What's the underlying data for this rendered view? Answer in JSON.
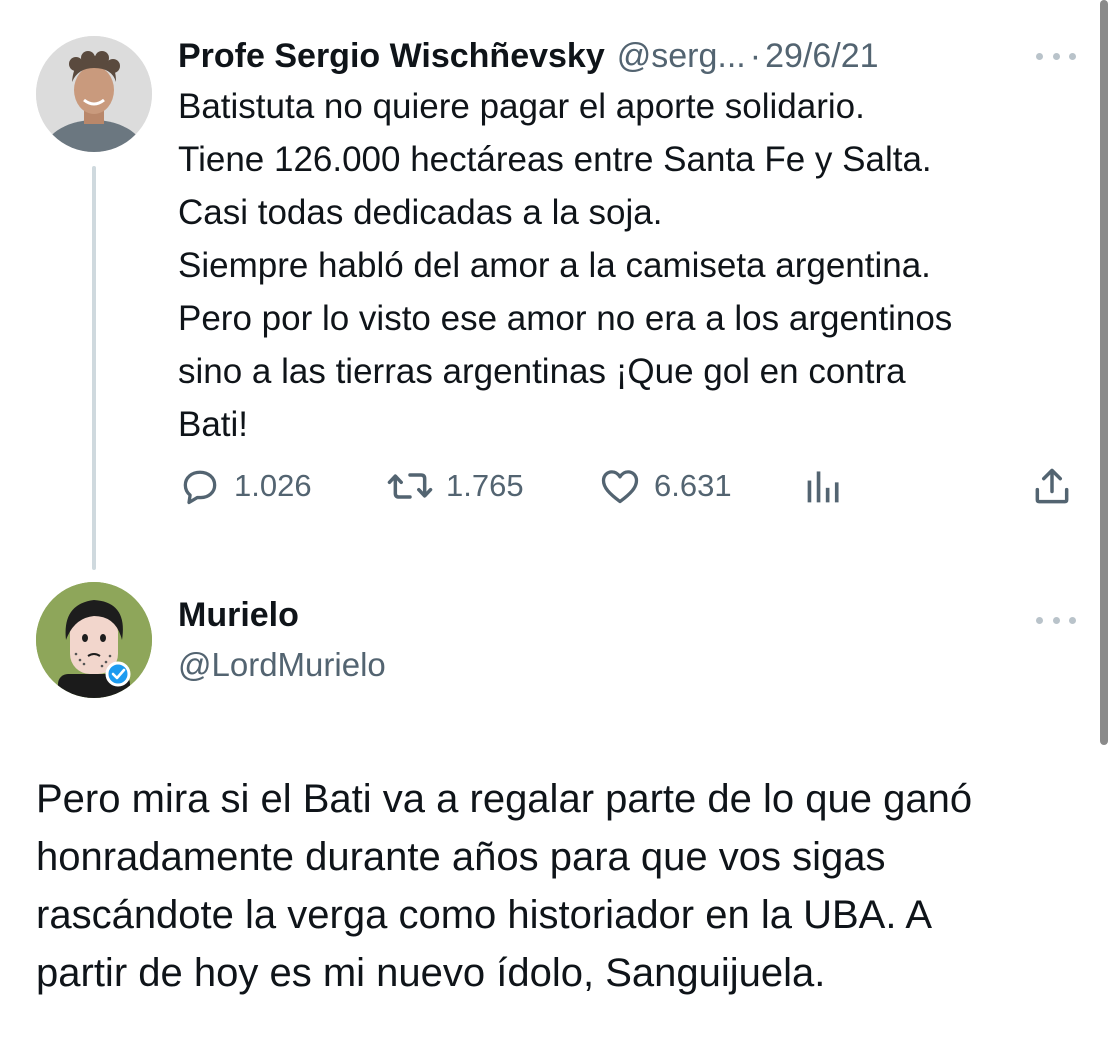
{
  "tweet": {
    "author": {
      "display_name": "Profe Sergio Wischñevsky",
      "handle": "@serg...",
      "avatar_icon": "profile-photo"
    },
    "separator": "·",
    "date": "29/6/21",
    "text_lines": [
      "Batistuta no quiere pagar el aporte solidario.",
      "Tiene 126.000 hectáreas entre Santa Fe y Salta.",
      "Casi todas dedicadas a la soja.",
      "Siempre habló del amor a la camiseta argentina.",
      "Pero por lo visto ese amor no era a los argentinos",
      "sino a las tierras argentinas ¡Que gol en contra",
      "Bati!"
    ],
    "actions": {
      "replies": "1.026",
      "retweets": "1.765",
      "likes": "6.631"
    }
  },
  "reply": {
    "author": {
      "display_name": "Murielo",
      "handle": "@LordMurielo",
      "avatar_icon": "cartoon-avatar",
      "verified": true
    },
    "text_lines": [
      "Pero mira si el Bati va a regalar parte de lo que ganó",
      "honradamente durante años para que vos sigas",
      "rascándote la verga como historiador en la UBA. A",
      "partir de hoy es mi nuevo ídolo, Sanguijuela."
    ]
  },
  "colors": {
    "text": "#0f1419",
    "secondary": "#536471",
    "thread_line": "#cfd9de",
    "verified": "#1d9bf0"
  }
}
